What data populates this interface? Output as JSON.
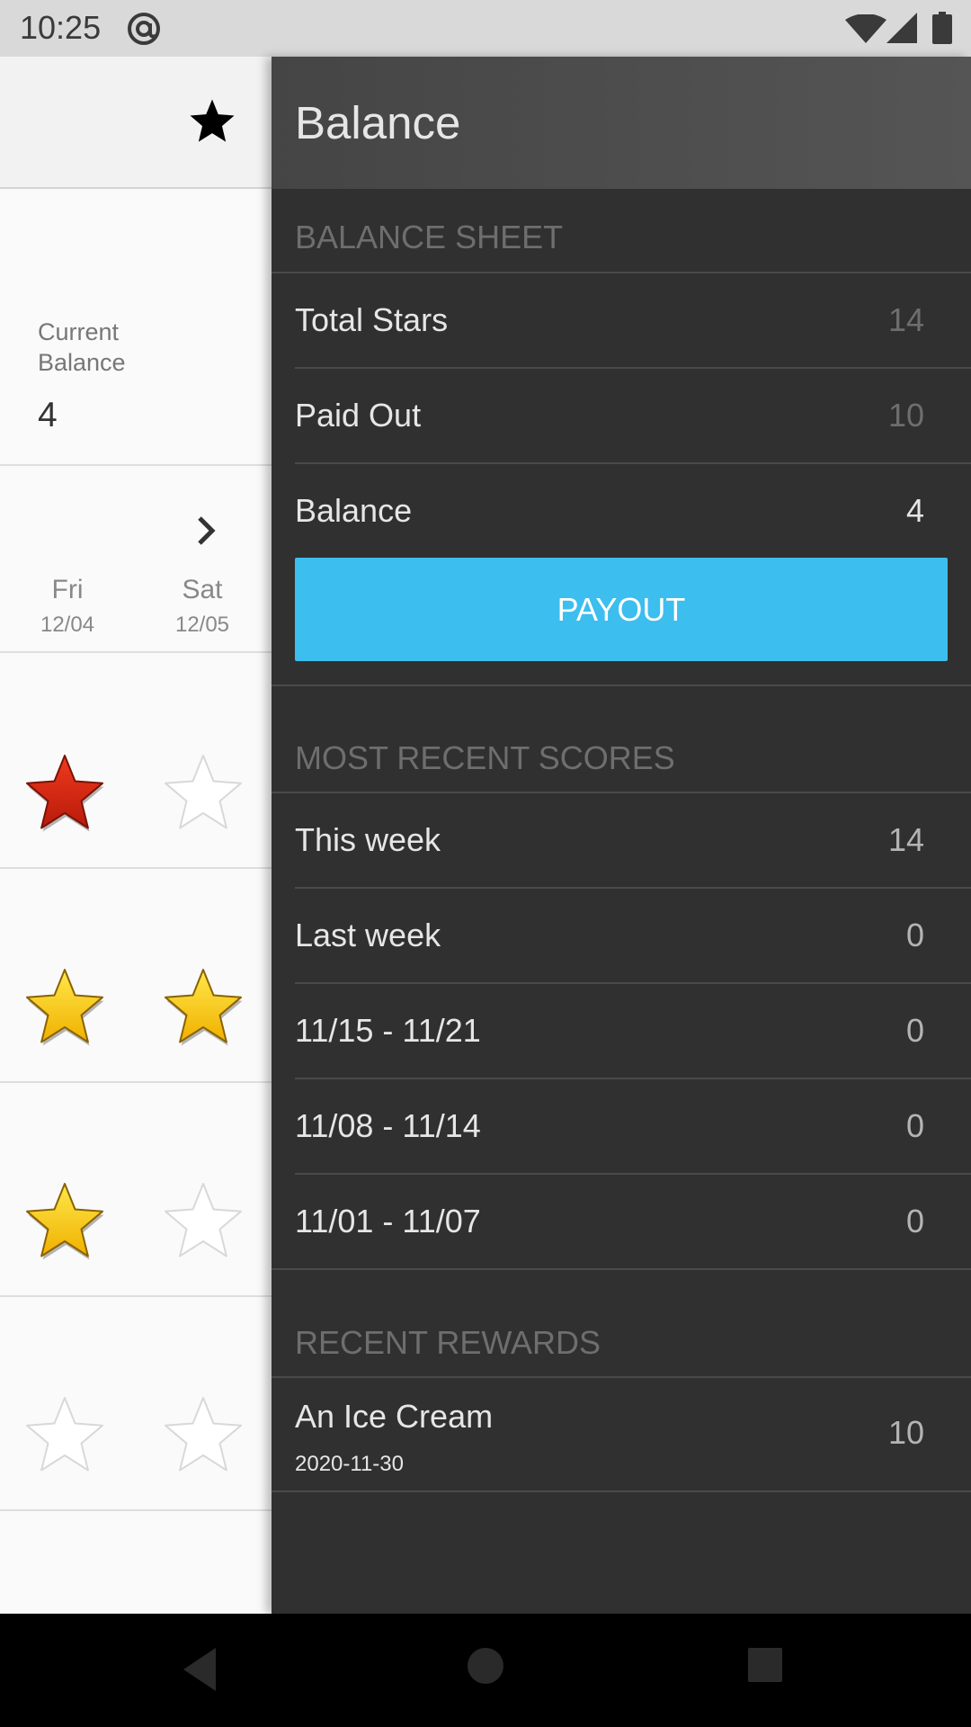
{
  "status_bar": {
    "time": "10:25"
  },
  "left_panel": {
    "current_balance_label": "Current Balance",
    "current_balance_value": "4",
    "days": [
      {
        "name": "Fri",
        "date": "12/04"
      },
      {
        "name": "Sat",
        "date": "12/05"
      }
    ],
    "star_rows": [
      [
        "red",
        "empty"
      ],
      [
        "gold",
        "gold"
      ],
      [
        "gold",
        "empty"
      ],
      [
        "empty",
        "empty"
      ]
    ]
  },
  "drawer": {
    "title": "Balance",
    "balance_sheet": {
      "header": "BALANCE SHEET",
      "rows": [
        {
          "label": "Total Stars",
          "value": "14"
        },
        {
          "label": "Paid Out",
          "value": "10"
        },
        {
          "label": "Balance",
          "value": "4"
        }
      ],
      "payout_label": "PAYOUT"
    },
    "recent_scores": {
      "header": "MOST RECENT SCORES",
      "rows": [
        {
          "label": "This week",
          "value": "14"
        },
        {
          "label": "Last week",
          "value": "0"
        },
        {
          "label": "11/15 - 11/21",
          "value": "0"
        },
        {
          "label": "11/08 - 11/14",
          "value": "0"
        },
        {
          "label": "11/01 - 11/07",
          "value": "0"
        }
      ]
    },
    "recent_rewards": {
      "header": "RECENT REWARDS",
      "rows": [
        {
          "label": "An Ice Cream",
          "date": "2020-11-30",
          "value": "10"
        }
      ]
    }
  },
  "colors": {
    "accent": "#3cbeee",
    "drawer_bg": "#303030",
    "star_red": "#d42a14",
    "star_gold": "#f8c814"
  }
}
